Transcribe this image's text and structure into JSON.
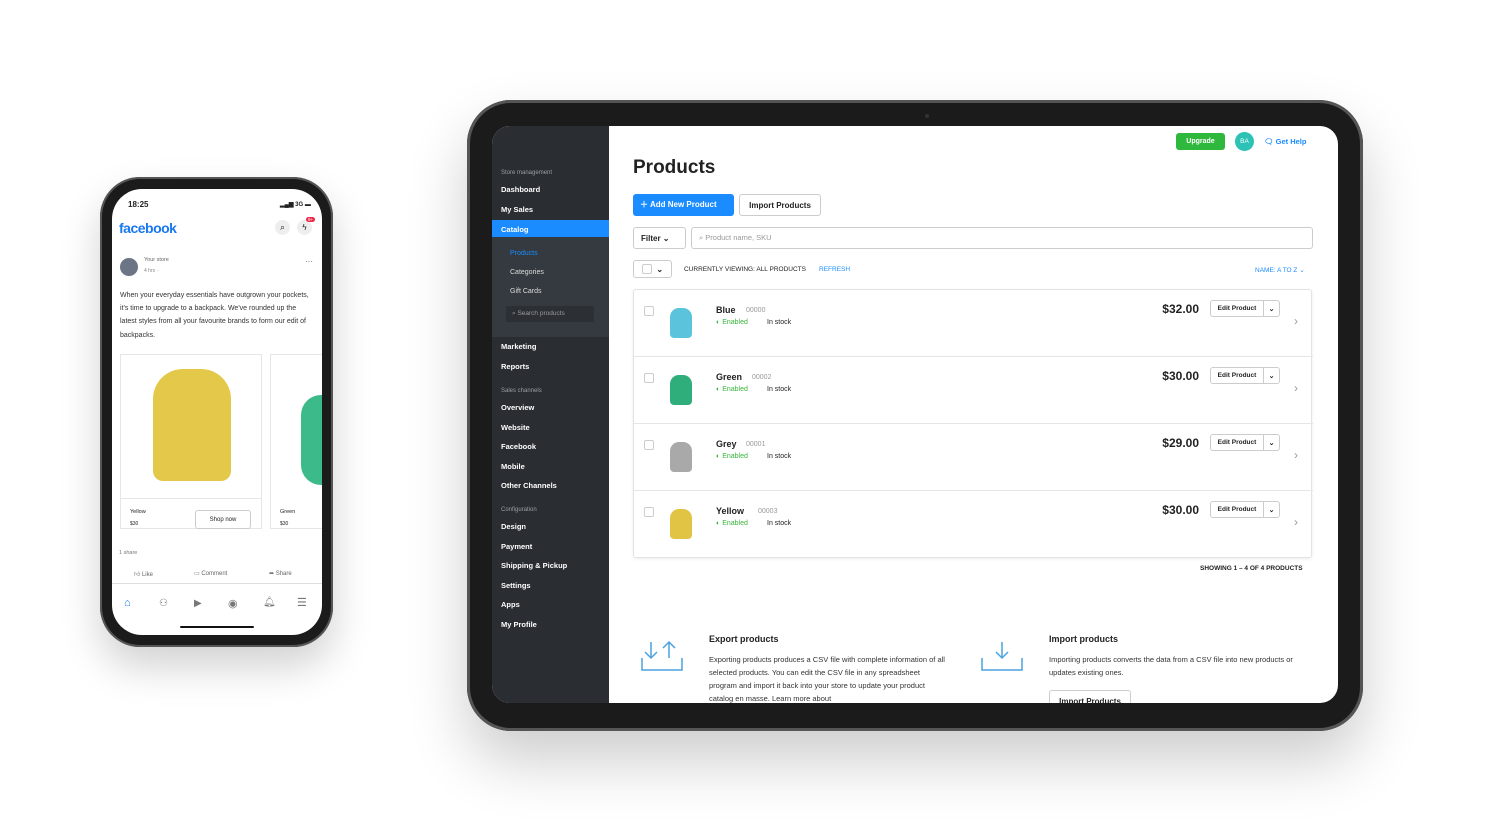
{
  "phone": {
    "time": "18:25",
    "network": "3G",
    "app_name": "facebook",
    "notification_badge": "9+",
    "post": {
      "author": "Your store",
      "meta": "4 hrs ·",
      "text": "When your everyday essentials have outgrown your pockets, it's time to upgrade to a backpack. We've rounded up the latest styles from all your favourite brands to form our edit of backpacks.",
      "products": [
        {
          "name": "Yellow",
          "price": "$30",
          "cta": "Shop now",
          "color": "#e3c84a"
        },
        {
          "name": "Green",
          "price": "$30",
          "color": "#3dba8a"
        }
      ],
      "shares": "1 share",
      "actions": [
        "Like",
        "Comment",
        "Share"
      ]
    }
  },
  "tablet": {
    "sidebar": {
      "sections": [
        "Store management",
        "Sales channels",
        "Configuration"
      ],
      "store_items": [
        "Dashboard",
        "My Sales",
        "Catalog"
      ],
      "catalog_sub": [
        "Products",
        "Categories",
        "Gift Cards"
      ],
      "search_placeholder": "Search products",
      "more_items": [
        "Marketing",
        "Reports"
      ],
      "channel_items": [
        "Overview",
        "Website",
        "Facebook",
        "Mobile",
        "Other Channels"
      ],
      "config_items": [
        "Design",
        "Payment",
        "Shipping & Pickup",
        "Settings",
        "Apps",
        "My Profile"
      ]
    },
    "header": {
      "upgrade": "Upgrade",
      "avatar": "BA",
      "help": "Get Help"
    },
    "title": "Products",
    "add_button": "Add New Product",
    "import_button": "Import Products",
    "filter": "Filter",
    "search_placeholder": "Product name, SKU",
    "viewing": "CURRENTLY VIEWING: ALL PRODUCTS",
    "refresh": "REFRESH",
    "sort": "NAME: A TO Z",
    "products": [
      {
        "name": "Blue",
        "sku": "00000",
        "status": "Enabled",
        "stock": "In stock",
        "price": "$32.00",
        "color": "#5cc3dc"
      },
      {
        "name": "Green",
        "sku": "00002",
        "status": "Enabled",
        "stock": "In stock",
        "price": "$30.00",
        "color": "#2fae7c"
      },
      {
        "name": "Grey",
        "sku": "00001",
        "status": "Enabled",
        "stock": "In stock",
        "price": "$29.00",
        "color": "#a9a9a9"
      },
      {
        "name": "Yellow",
        "sku": "00003",
        "status": "Enabled",
        "stock": "In stock",
        "price": "$30.00",
        "color": "#e2c444"
      }
    ],
    "edit_label": "Edit Product",
    "showing": "SHOWING 1 – 4 OF 4 PRODUCTS",
    "export": {
      "title": "Export products",
      "text": "Exporting products produces a CSV file with complete information of all selected products. You can edit the CSV file in any spreadsheet program and import it back into your store to update your product catalog en masse. Learn more about"
    },
    "import": {
      "title": "Import products",
      "text": "Importing products converts the data from a CSV file into new products or updates existing ones.",
      "button": "Import Products"
    }
  },
  "colors": {
    "accent": "#1a8cff",
    "upgrade": "#2eb83d",
    "enabled": "#39b53c",
    "sidebar": "#2a2d31"
  }
}
